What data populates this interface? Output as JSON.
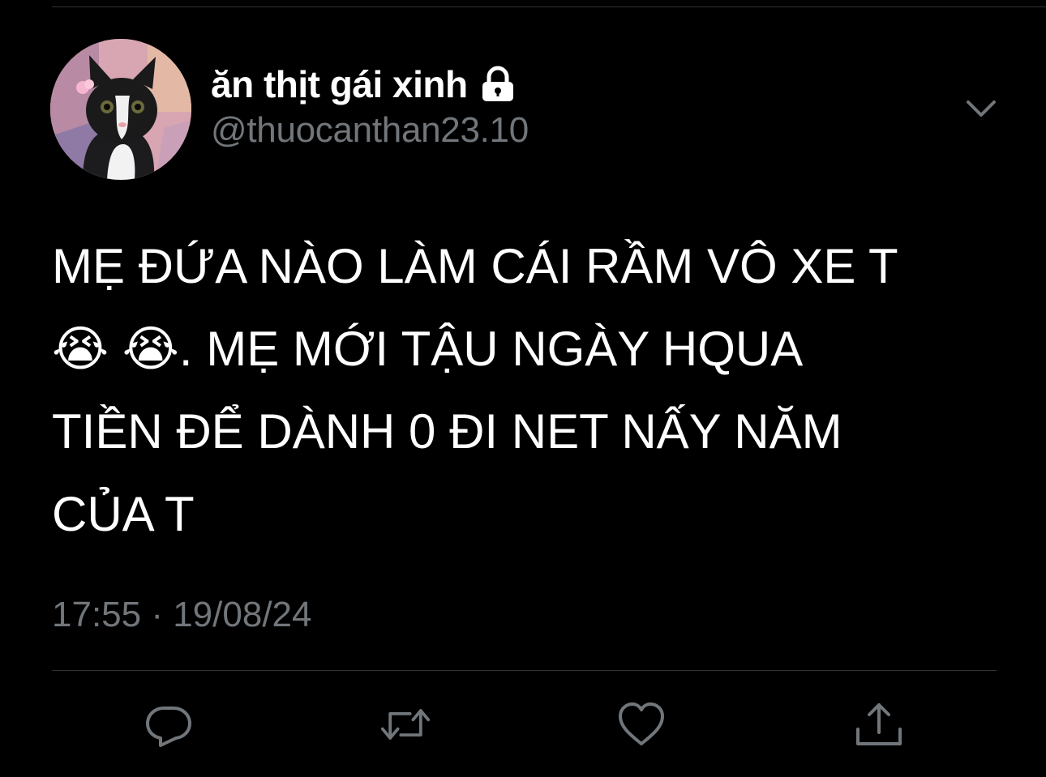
{
  "tweet": {
    "author": {
      "display_name": "ăn thịt gái xinh",
      "handle": "@thuocanthan23.10",
      "avatar_icon": "cat-avatar",
      "protected_icon": "lock-icon"
    },
    "text": "MẸ ĐỨA NÀO LÀM CÁI RẦM VÔ XE T\n😭 😭. MẸ MỚI TẬU NGÀY HQUA\nTIỀN ĐỂ DÀNH 0 ĐI NET NẤY NĂM\nCỦA T",
    "timestamp": "17:55 · 19/08/24"
  },
  "actions": {
    "reply_icon": "reply-icon",
    "retweet_icon": "retweet-icon",
    "like_icon": "heart-icon",
    "share_icon": "share-icon",
    "more_icon": "chevron-down-icon"
  },
  "colors": {
    "background": "#000000",
    "primary_text": "#ffffff",
    "secondary_text": "#71767b",
    "divider": "#2f3336"
  }
}
